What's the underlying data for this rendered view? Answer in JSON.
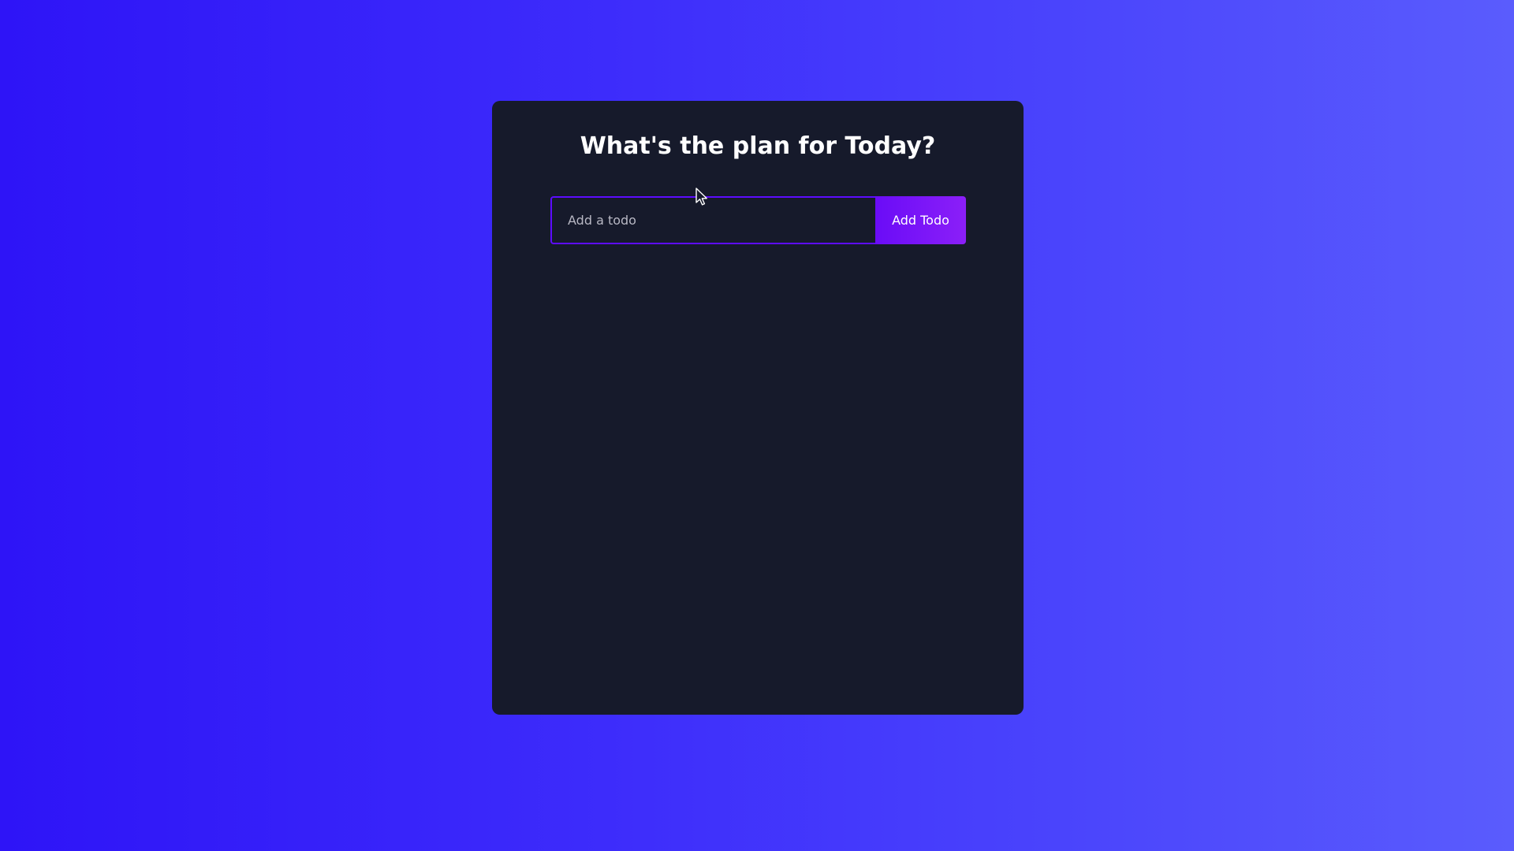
{
  "app": {
    "title": "What's the plan for Today?"
  },
  "form": {
    "input_value": "",
    "input_placeholder": "Add a todo",
    "button_label": "Add Todo"
  },
  "colors": {
    "background_start": "#2e14f7",
    "background_end": "#5a5cfd",
    "card": "#161a2b",
    "accent": "#5d0cff",
    "button": "#8b1ff8"
  },
  "icons": {
    "cursor": "mouse-pointer-icon"
  }
}
